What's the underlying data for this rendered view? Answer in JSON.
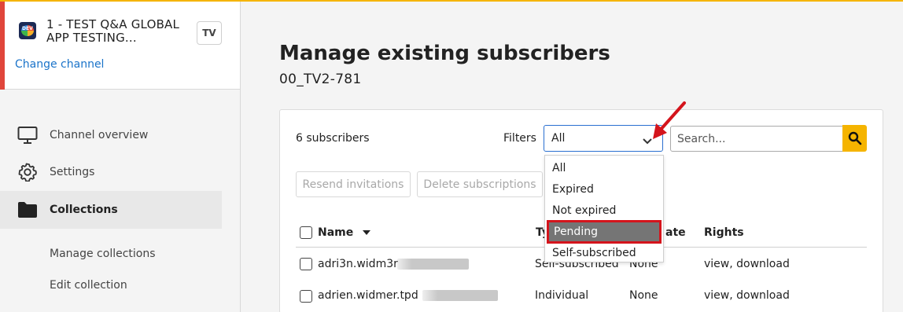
{
  "channel": {
    "name": "1 - TEST Q&A GLOBAL APP TESTING...",
    "badge": "TV",
    "logo_text": "DEV",
    "change_label": "Change channel"
  },
  "nav": {
    "items": [
      {
        "label": "Channel overview",
        "icon": "monitor-icon"
      },
      {
        "label": "Settings",
        "icon": "gear-icon"
      },
      {
        "label": "Collections",
        "icon": "folder-icon",
        "active": true
      }
    ],
    "sub_items": [
      {
        "label": "Manage collections"
      },
      {
        "label": "Edit collection"
      }
    ]
  },
  "main": {
    "title": "Manage existing subscribers",
    "subtitle": "00_TV2-781",
    "subscriber_count": "6  subscribers",
    "filters_label": "Filters",
    "filter_value": "All",
    "search_placeholder": "Search...",
    "buttons": {
      "resend": "Resend invitations",
      "delete": "Delete subscriptions"
    },
    "columns": {
      "name": "Name",
      "type": "Ty",
      "date": "ate",
      "rights": "Rights"
    },
    "rows": [
      {
        "name": "adri3n.widm3r",
        "type": "Self-subscribed",
        "date": "None",
        "rights": "view, download"
      },
      {
        "name": "adrien.widmer.tpd",
        "type": "Individual",
        "date": "None",
        "rights": "view, download"
      }
    ]
  },
  "dropdown": {
    "options": [
      "All",
      "Expired",
      "Not expired",
      "Pending",
      "Self-subscribed"
    ],
    "selected": "Pending"
  },
  "colors": {
    "accent": "#f5b400",
    "channel_accent": "#e0463b",
    "link": "#1a73c9",
    "highlight_border": "#d4141c",
    "arrow": "#d4141c"
  }
}
